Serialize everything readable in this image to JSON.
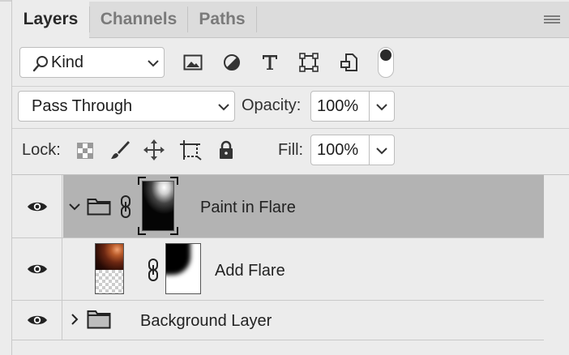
{
  "tabs": [
    {
      "label": "Layers",
      "active": true
    },
    {
      "label": "Channels",
      "active": false
    },
    {
      "label": "Paths",
      "active": false
    }
  ],
  "filter": {
    "kind_label": "Kind",
    "icons": [
      "image-filter-icon",
      "adjustment-filter-icon",
      "type-filter-icon",
      "shape-filter-icon",
      "smart-object-filter-icon"
    ]
  },
  "blend": {
    "mode": "Pass Through",
    "opacity_label": "Opacity:",
    "opacity_value": "100%"
  },
  "lock": {
    "label": "Lock:",
    "fill_label": "Fill:",
    "fill_value": "100%"
  },
  "layers": [
    {
      "name": "Paint in Flare",
      "type": "group",
      "expanded": true,
      "selected": true
    },
    {
      "name": "Add Flare",
      "type": "layer",
      "has_mask": true
    },
    {
      "name": "Background Layer",
      "type": "group",
      "expanded": false
    }
  ],
  "colors": {
    "panel_bg": "#ececec",
    "tab_bg": "#dcdcdc",
    "selected_row": "#b3b3b3"
  }
}
